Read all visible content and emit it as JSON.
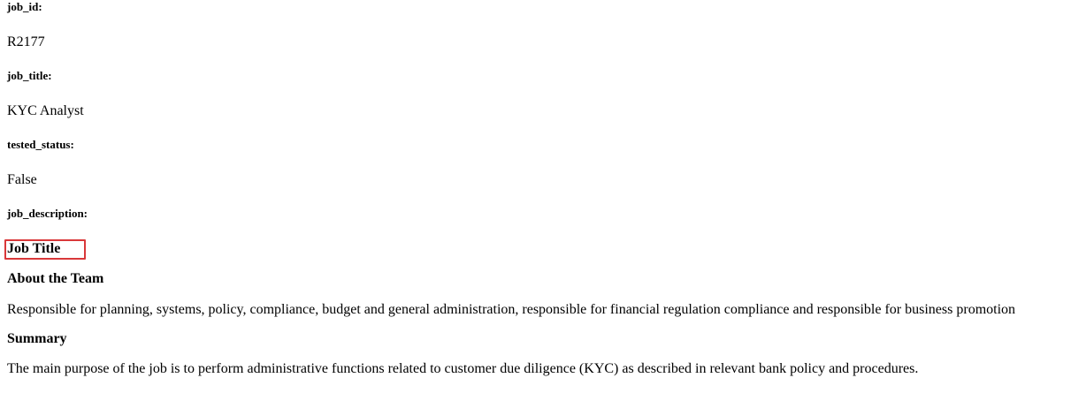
{
  "fields": {
    "job_id": {
      "label": "job_id:",
      "value": "R2177"
    },
    "job_title": {
      "label": "job_title:",
      "value": "KYC Analyst"
    },
    "tested_status": {
      "label": "tested_status:",
      "value": "False"
    },
    "job_description": {
      "label": "job_description:"
    }
  },
  "description": {
    "title_heading": "Job Title",
    "team_heading": "About the Team",
    "team_text": "Responsible for planning, systems, policy, compliance, budget and general administration, responsible for financial regulation compliance and responsible for business promotion",
    "summary_heading": "Summary",
    "summary_text": "The main purpose of the job is to perform administrative functions related to customer due diligence (KYC) as described in relevant bank policy and procedures."
  },
  "highlight": {
    "color": "#d9383a",
    "target": "Job Title"
  }
}
